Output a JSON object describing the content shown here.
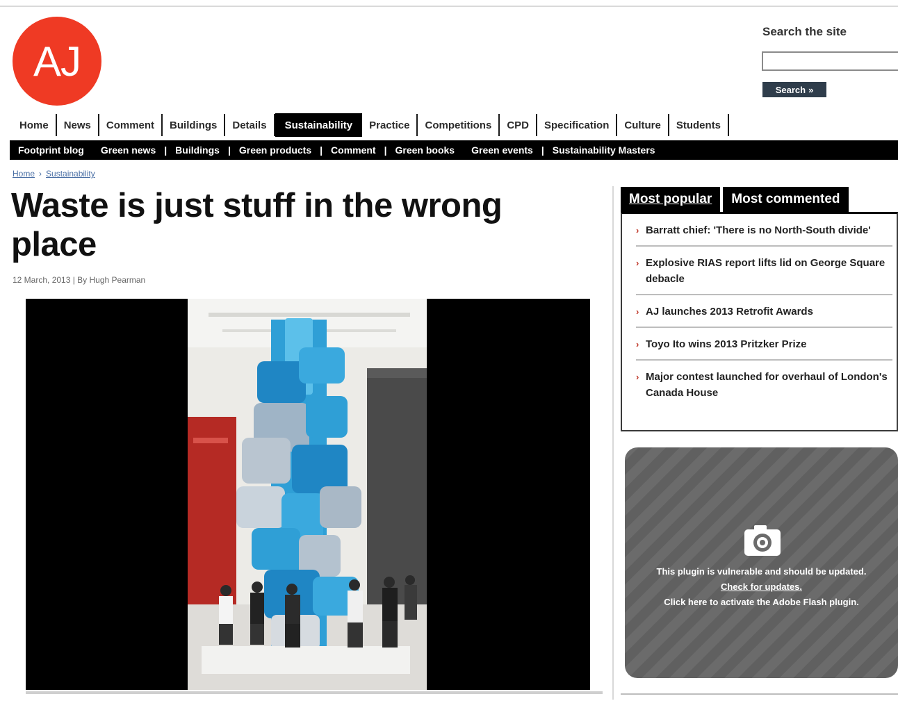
{
  "brand": {
    "logo_text": "AJ",
    "logo_color": "#ef3a24"
  },
  "search": {
    "label": "Search the site",
    "value": "",
    "button_label": "Search",
    "button_arrow": "»"
  },
  "nav": {
    "items": [
      {
        "label": "Home",
        "active": false
      },
      {
        "label": "News",
        "active": false
      },
      {
        "label": "Comment",
        "active": false
      },
      {
        "label": "Buildings",
        "active": false
      },
      {
        "label": "Details",
        "active": false
      },
      {
        "label": "Sustainability",
        "active": true
      },
      {
        "label": "Practice",
        "active": false
      },
      {
        "label": "Competitions",
        "active": false
      },
      {
        "label": "CPD",
        "active": false
      },
      {
        "label": "Specification",
        "active": false
      },
      {
        "label": "Culture",
        "active": false
      },
      {
        "label": "Students",
        "active": false
      }
    ]
  },
  "subnav": {
    "items": [
      "Footprint blog",
      "Green news",
      "Buildings",
      "Green products",
      "Comment",
      "Green books",
      "Green events",
      "Sustainability Masters"
    ]
  },
  "breadcrumb": {
    "home": "Home",
    "separator": "›",
    "current": "Sustainability"
  },
  "article": {
    "title": "Waste is just stuff in the wrong place",
    "byline": "12 March, 2013 | By Hugh Pearman"
  },
  "sidebar": {
    "tabs": [
      {
        "label": "Most popular",
        "active": true
      },
      {
        "label": "Most commented",
        "active": false
      }
    ],
    "bullet": "›",
    "popular": [
      "Barratt chief: 'There is no North-South divide'",
      "Explosive RIAS report lifts lid on George Square debacle",
      "AJ launches 2013 Retrofit Awards",
      "Toyo Ito wins 2013 Pritzker Prize",
      "Major contest launched for overhaul of London's Canada House"
    ]
  },
  "plugin": {
    "icon": "camera-icon",
    "message": "This plugin is vulnerable and should be updated.",
    "link": "Check for updates.",
    "activate": "Click here to activate the Adobe Flash plugin."
  }
}
